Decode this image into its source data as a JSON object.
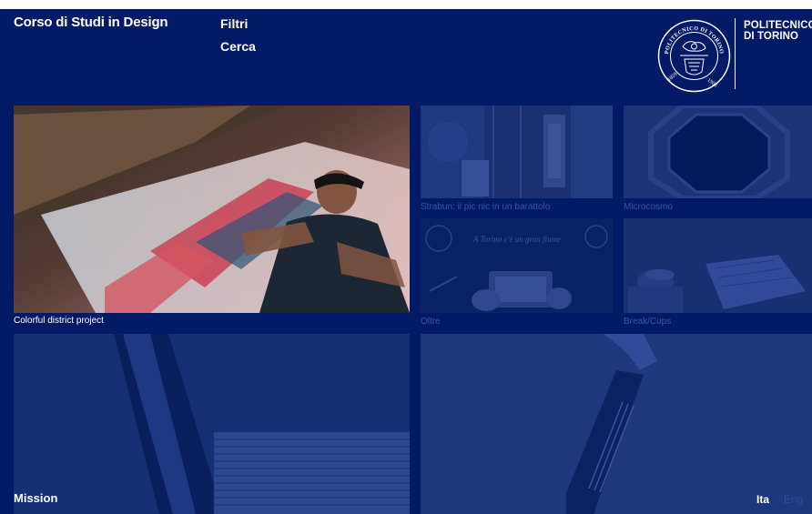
{
  "header": {
    "site_title": "Corso di Studi in Design",
    "nav": {
      "filters": "Filtri",
      "search": "Cerca"
    },
    "logo": {
      "line1": "POLITECNICO",
      "line2": "DI TORINO",
      "seal_text": "POLITECNICO DI TORINO",
      "seal_year_left": "1859",
      "seal_year_right": "1906"
    }
  },
  "projects": [
    {
      "title": "Colorful district project"
    },
    {
      "title": "Strabun: il pic nic in un barattolo"
    },
    {
      "title": "Microcosmo"
    },
    {
      "title": "Oltre"
    },
    {
      "title": "Break/Cups"
    }
  ],
  "oltre_handwriting": "A Torino c'è un gran fiume",
  "footer": {
    "mission": "Mission",
    "lang_ita": "Ita",
    "lang_eng": "Eng"
  },
  "colors": {
    "background": "#031a66",
    "text": "#ffffff",
    "faded_caption": "#3a54a8",
    "inactive_lang": "#2c4aa6"
  }
}
